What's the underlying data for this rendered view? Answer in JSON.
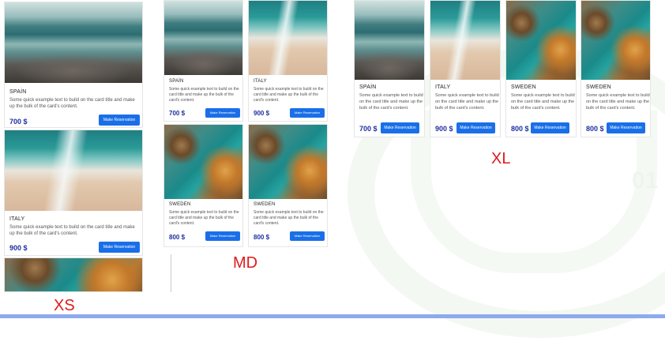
{
  "cards": {
    "spain": {
      "title": "SPAİN",
      "price": "700 $"
    },
    "italy": {
      "title": "ITALY",
      "price": "900 $"
    },
    "sweden": {
      "title": "SWEDEN",
      "price": "800 $"
    },
    "text": "Some quick example text to build on the card title and make up the bulk of the card's content.",
    "button": "Make Reservation"
  },
  "labels": {
    "xs": "XS",
    "md": "MD",
    "xl": "XL"
  },
  "background": {
    "number": "01"
  },
  "colors": {
    "accent": "#1a6fe8",
    "price": "#1f2fa0",
    "size_label": "#e01a1a",
    "bottom_bar": "#8eaaee"
  }
}
